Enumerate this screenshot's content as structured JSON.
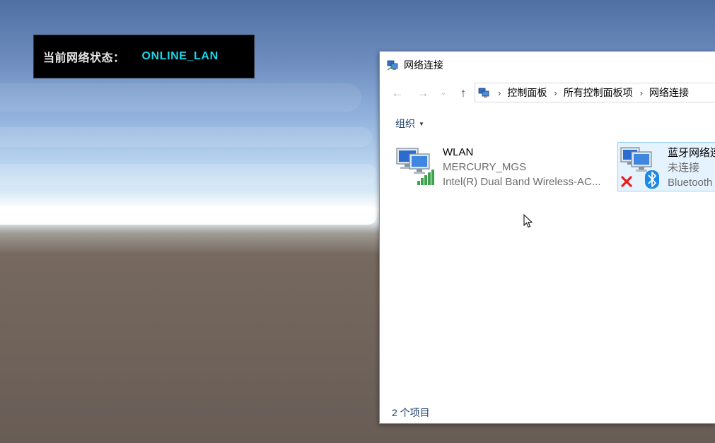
{
  "overlay": {
    "label": "当前网络状态：",
    "value": "ONLINE_LAN",
    "value_color": "#19d7e8"
  },
  "window": {
    "title": "网络连接",
    "icon": "network-connections-icon",
    "nav": {
      "back": "←",
      "forward": "→",
      "dropdown": "⌄",
      "up": "↑"
    },
    "breadcrumbs": [
      "控制面板",
      "所有控制面板项",
      "网络连接"
    ],
    "breadcrumb_sep": "›",
    "toolbar": {
      "organize_label": "组织",
      "organize_caret": "▼"
    },
    "items": [
      {
        "name": "WLAN",
        "line2": "MERCURY_MGS",
        "line3": "Intel(R) Dual Band Wireless-AC...",
        "icon": "wifi-adapter-icon",
        "selected": false
      },
      {
        "name": "蓝牙网络连",
        "line2": "未连接",
        "line3": "Bluetooth",
        "icon": "bluetooth-adapter-icon",
        "status_icon": "disconnected-x-icon",
        "selected": true
      }
    ],
    "status_text": "2 个项目"
  },
  "colors": {
    "accent": "#1e3e6b",
    "selection_bg": "#e5f3ff",
    "selection_border": "#99d1ff",
    "bluetooth": "#1e88e5",
    "error": "#e02020",
    "signal": "#3fa34d"
  }
}
